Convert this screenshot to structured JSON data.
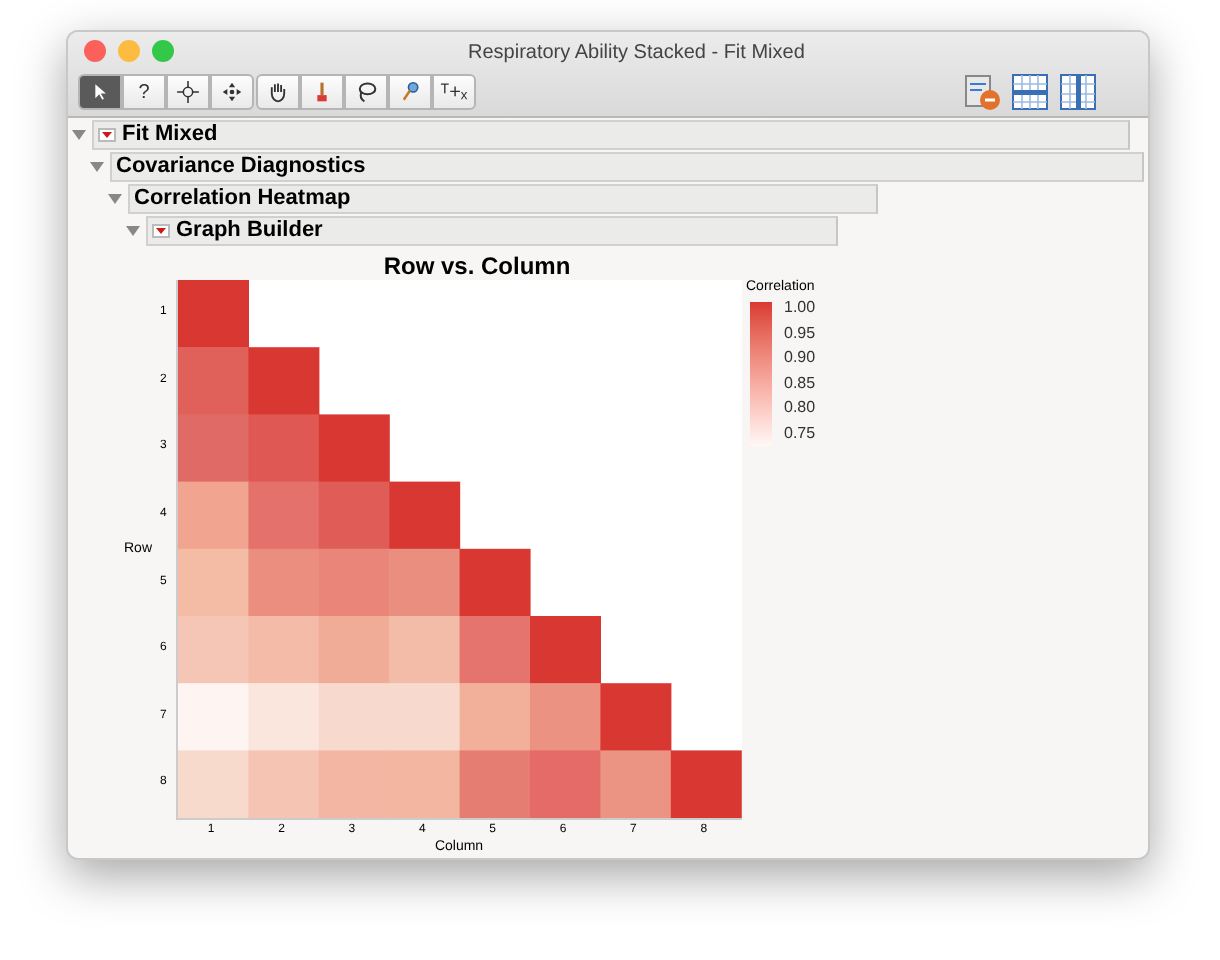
{
  "window": {
    "title": "Respiratory Ability Stacked - Fit Mixed"
  },
  "toolbar": {
    "tools": [
      {
        "kind": "arrow",
        "selected": true
      },
      {
        "kind": "help",
        "selected": false
      },
      {
        "kind": "scroll",
        "selected": false
      },
      {
        "kind": "move",
        "selected": false
      },
      {
        "kind": "hand",
        "selected": false
      },
      {
        "kind": "brush",
        "selected": false
      },
      {
        "kind": "lasso",
        "selected": false
      },
      {
        "kind": "magnifier",
        "selected": false
      },
      {
        "kind": "annotate",
        "selected": false
      }
    ],
    "help_label": "?",
    "annotate_label": "ᵀ+ₓ"
  },
  "outline": [
    {
      "title": "Fit Mixed",
      "menu": true,
      "expanded": true,
      "children": [
        {
          "title": "Covariance Diagnostics",
          "menu": false,
          "expanded": true,
          "children": [
            {
              "title": "Correlation Heatmap",
              "menu": false,
              "expanded": true,
              "children": [
                {
                  "title": "Graph Builder",
                  "menu": true,
                  "expanded": true
                }
              ]
            }
          ]
        }
      ]
    }
  ],
  "heatmap": {
    "title": "Row vs. Column",
    "ylabel": "Row",
    "xlabel": "Column",
    "columns": [
      "1",
      "2",
      "3",
      "4",
      "5",
      "6",
      "7",
      "8"
    ],
    "rows": [
      {
        "label": "1",
        "cells": [
          {
            "color": "#d93832"
          }
        ]
      },
      {
        "label": "2",
        "cells": [
          {
            "color": "#e0605a"
          },
          {
            "color": "#d93832"
          }
        ]
      },
      {
        "label": "3",
        "cells": [
          {
            "color": "#e06a65"
          },
          {
            "color": "#df5853"
          },
          {
            "color": "#d93832"
          }
        ]
      },
      {
        "label": "4",
        "cells": [
          {
            "color": "#f1a590"
          },
          {
            "color": "#e4716b"
          },
          {
            "color": "#e05d57"
          },
          {
            "color": "#d93832"
          }
        ]
      },
      {
        "label": "5",
        "cells": [
          {
            "color": "#f4bba5"
          },
          {
            "color": "#eb8e7f"
          },
          {
            "color": "#e98579"
          },
          {
            "color": "#ea8e80"
          },
          {
            "color": "#d93832"
          }
        ]
      },
      {
        "label": "6",
        "cells": [
          {
            "color": "#f5c6b5"
          },
          {
            "color": "#f4bca8"
          },
          {
            "color": "#f1ac98"
          },
          {
            "color": "#f3bca8"
          },
          {
            "color": "#e4746d"
          },
          {
            "color": "#d93832"
          }
        ]
      },
      {
        "label": "7",
        "cells": [
          {
            "color": "#fef4f1"
          },
          {
            "color": "#fae6dd"
          },
          {
            "color": "#f8d9cd"
          },
          {
            "color": "#f7d9cd"
          },
          {
            "color": "#f2b09a"
          },
          {
            "color": "#eb9282"
          },
          {
            "color": "#d93832"
          }
        ]
      },
      {
        "label": "8",
        "cells": [
          {
            "color": "#f8dacd"
          },
          {
            "color": "#f5c4b2"
          },
          {
            "color": "#f3b6a2"
          },
          {
            "color": "#f3b6a1"
          },
          {
            "color": "#e57d72"
          },
          {
            "color": "#e46b67"
          },
          {
            "color": "#ec9484"
          },
          {
            "color": "#d93832"
          }
        ]
      }
    ],
    "legend": {
      "title": "Correlation",
      "ticks": [
        "1.00",
        "0.95",
        "0.90",
        "0.85",
        "0.80",
        "0.75"
      ]
    }
  }
}
